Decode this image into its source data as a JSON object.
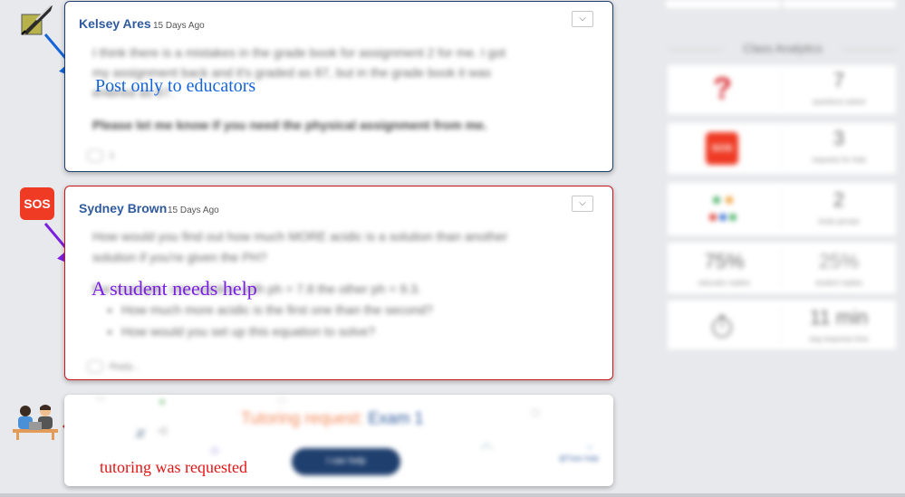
{
  "posts": [
    {
      "author": "Kelsey Ares",
      "time": "15 Days Ago",
      "lines": [
        "I think there is a mistakes in the grade book for assignment 2 for me. I got",
        "my assignment back and it's graded as 87, but in the grade book it was",
        "entered as 67."
      ],
      "bold_line": "Please let me know if you need the physical assignment from me.",
      "reply_count": "1",
      "annotation": "Post only to educators"
    },
    {
      "author": "Sydney Brown",
      "time": "15 Days Ago",
      "lines": [
        "How would you find out how much MORE acidic is a solution than another",
        "solution if you're given the PH?",
        "For example, one solution with ph = 7.8 the other ph = 9.3."
      ],
      "bullets": [
        "How much more acidic is the first one than the second?",
        "How would you set up this equation to solve?"
      ],
      "reply_label": "Reply...",
      "badge": "SOS",
      "annotation": "A student needs help"
    }
  ],
  "tutoring": {
    "prefix": "Tutoring request:",
    "subject": "Exam 1",
    "button": "I can help",
    "corner_text": "@Tutor help",
    "annotation": "tutoring was requested"
  },
  "analytics": {
    "title": "Class Analytics",
    "rows": [
      {
        "icon": "question-mark-icon",
        "value": "7",
        "label": "questions asked"
      },
      {
        "icon": "sos-icon",
        "icon_text": "SOS",
        "value": "3",
        "label": "requests for help"
      },
      {
        "icon": "group-icon",
        "value": "2",
        "label": "study groups"
      },
      {
        "value": "75%",
        "label": "educator replies",
        "value2": "25%",
        "label2": "student replies"
      },
      {
        "icon": "timer-icon",
        "value": "11 min",
        "label": "avg response time"
      }
    ]
  },
  "colors": {
    "brand_blue": "#2f5a9c",
    "navy": "#1f3f6e",
    "alert_red": "#c9161d",
    "annot_blue": "#1565d8",
    "annot_purple": "#7a1fe0",
    "annot_red": "#e31414",
    "tutor_orange": "#f28a5c"
  }
}
